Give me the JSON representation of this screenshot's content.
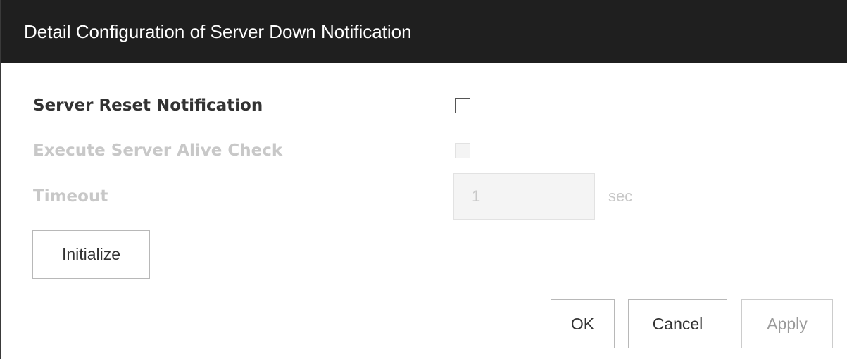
{
  "dialog": {
    "title": "Detail Configuration of Server Down Notification"
  },
  "fields": {
    "server_reset_notification": {
      "label": "Server Reset Notification",
      "checked": false,
      "enabled": true
    },
    "execute_server_alive_check": {
      "label": "Execute Server Alive Check",
      "checked": false,
      "enabled": false
    },
    "timeout": {
      "label": "Timeout",
      "value": "1",
      "unit": "sec",
      "enabled": false
    }
  },
  "buttons": {
    "initialize": "Initialize",
    "ok": "OK",
    "cancel": "Cancel",
    "apply": "Apply"
  },
  "colors": {
    "titlebar_bg": "#1f1f1f",
    "title_text": "#ffffff",
    "label_text": "#333333",
    "disabled_text": "#c8c8c8"
  }
}
